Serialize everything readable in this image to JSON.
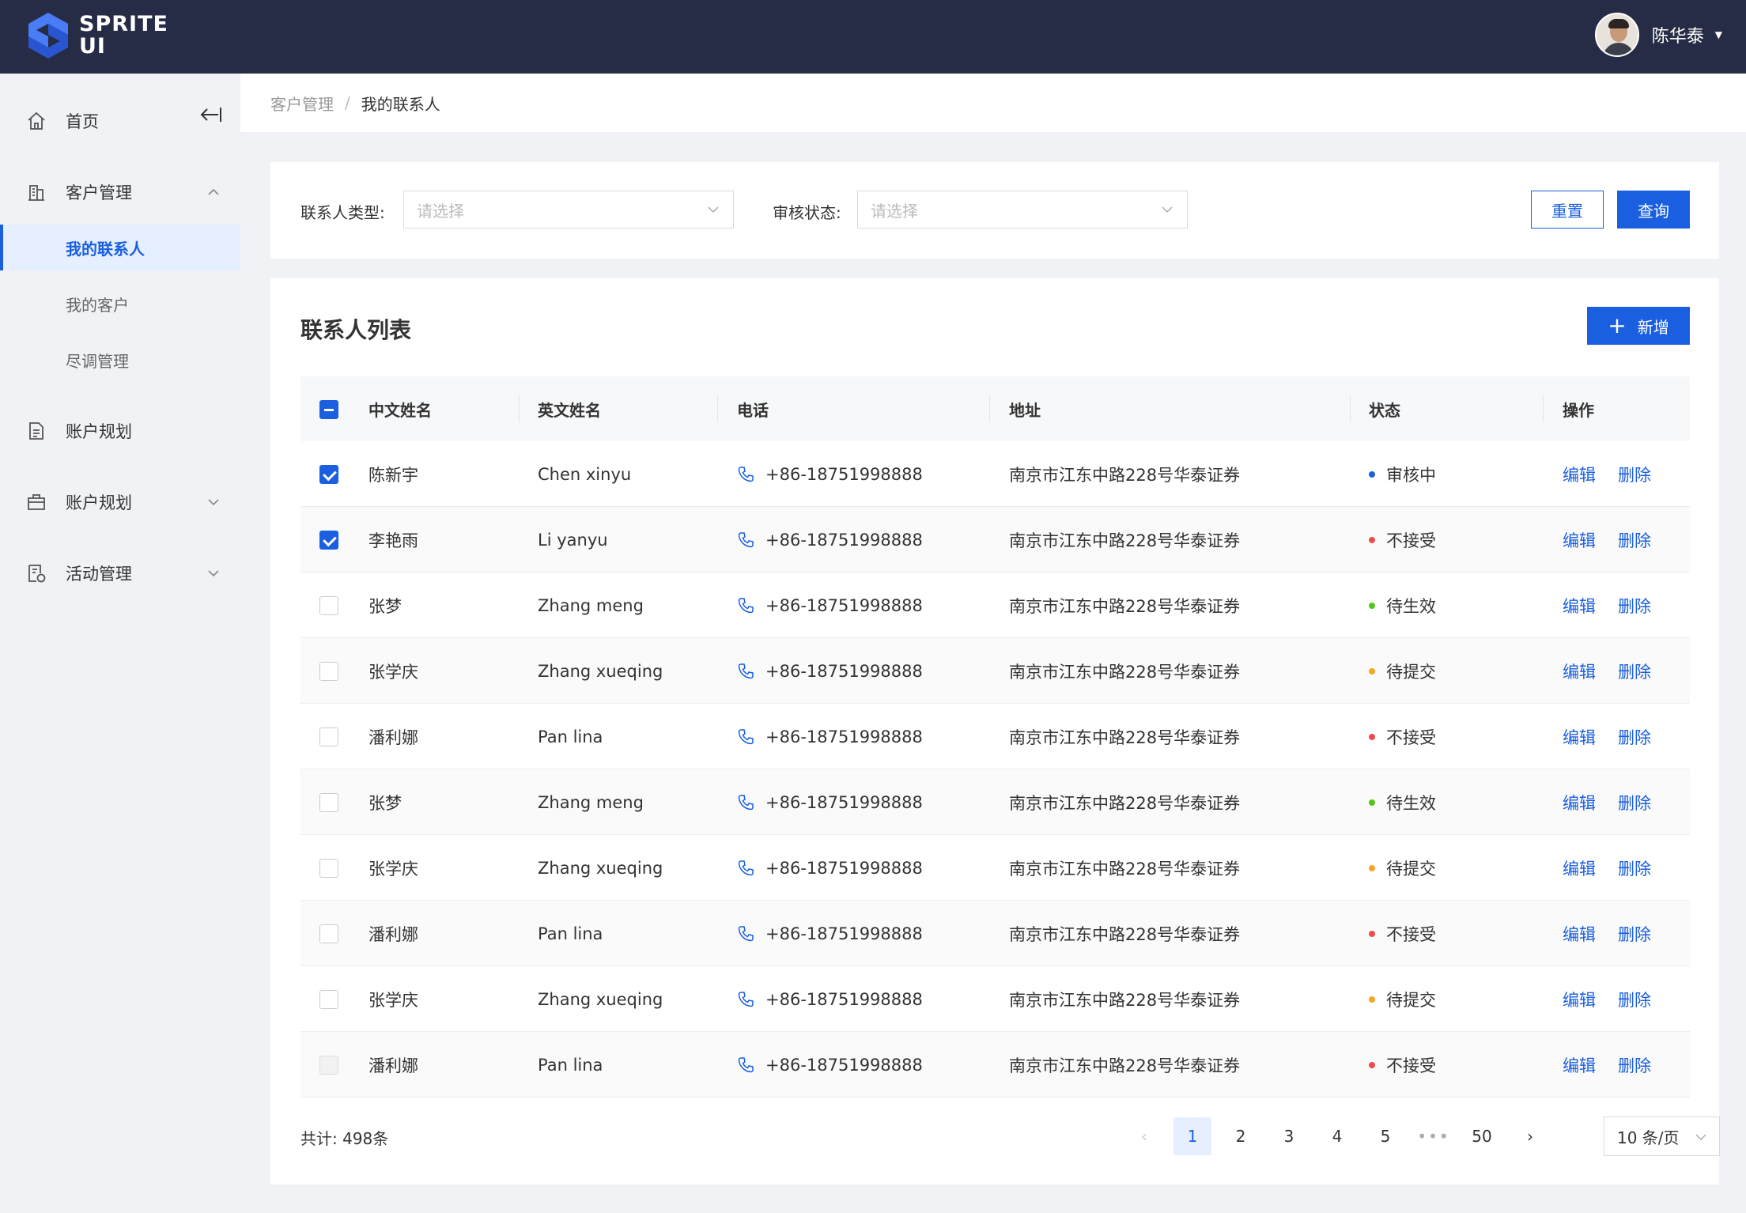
{
  "header": {
    "logo_line1": "SPRITE",
    "logo_line2": "UI",
    "user_name": "陈华泰"
  },
  "sidebar": {
    "items": [
      {
        "label": "首页",
        "icon": "home-icon"
      },
      {
        "label": "客户管理",
        "icon": "building-icon",
        "expanded": true,
        "children": [
          {
            "label": "我的联系人",
            "active": true
          },
          {
            "label": "我的客户"
          },
          {
            "label": "尽调管理"
          }
        ]
      },
      {
        "label": "账户规划",
        "icon": "document-icon"
      },
      {
        "label": "账户规划",
        "icon": "briefcase-icon",
        "expanded": false
      },
      {
        "label": "活动管理",
        "icon": "calendar-list-icon",
        "expanded": false
      }
    ]
  },
  "breadcrumb": {
    "parent": "客户管理",
    "separator": "/",
    "current": "我的联系人"
  },
  "filters": {
    "contact_type_label": "联系人类型:",
    "contact_type_placeholder": "请选择",
    "review_status_label": "审核状态:",
    "review_status_placeholder": "请选择",
    "reset_label": "重置",
    "query_label": "查询"
  },
  "list": {
    "title": "联系人列表",
    "add_label": "新增",
    "columns": [
      "中文姓名",
      "英文姓名",
      "电话",
      "地址",
      "状态",
      "操作"
    ],
    "edit_label": "编辑",
    "delete_label": "删除",
    "rows": [
      {
        "cn": "陈新宇",
        "en": "Chen xinyu",
        "phone": "+86-18751998888",
        "address": "南京市江东中路228号华泰证券",
        "status": "审核中",
        "status_color": "#1a5fe0",
        "checked": true
      },
      {
        "cn": "李艳雨",
        "en": "Li yanyu",
        "phone": "+86-18751998888",
        "address": "南京市江东中路228号华泰证券",
        "status": "不接受",
        "status_color": "#f04b4b",
        "checked": true
      },
      {
        "cn": "张梦",
        "en": "Zhang meng",
        "phone": "+86-18751998888",
        "address": "南京市江东中路228号华泰证券",
        "status": "待生效",
        "status_color": "#52c41a",
        "checked": false
      },
      {
        "cn": "张学庆",
        "en": "Zhang xueqing",
        "phone": "+86-18751998888",
        "address": "南京市江东中路228号华泰证券",
        "status": "待提交",
        "status_color": "#f5a623",
        "checked": false
      },
      {
        "cn": "潘利娜",
        "en": "Pan lina",
        "phone": "+86-18751998888",
        "address": "南京市江东中路228号华泰证券",
        "status": "不接受",
        "status_color": "#f04b4b",
        "checked": false
      },
      {
        "cn": "张梦",
        "en": "Zhang meng",
        "phone": "+86-18751998888",
        "address": "南京市江东中路228号华泰证券",
        "status": "待生效",
        "status_color": "#52c41a",
        "checked": false
      },
      {
        "cn": "张学庆",
        "en": "Zhang xueqing",
        "phone": "+86-18751998888",
        "address": "南京市江东中路228号华泰证券",
        "status": "待提交",
        "status_color": "#f5a623",
        "checked": false
      },
      {
        "cn": "潘利娜",
        "en": "Pan lina",
        "phone": "+86-18751998888",
        "address": "南京市江东中路228号华泰证券",
        "status": "不接受",
        "status_color": "#f04b4b",
        "checked": false
      },
      {
        "cn": "张学庆",
        "en": "Zhang xueqing",
        "phone": "+86-18751998888",
        "address": "南京市江东中路228号华泰证券",
        "status": "待提交",
        "status_color": "#f5a623",
        "checked": false
      },
      {
        "cn": "潘利娜",
        "en": "Pan lina",
        "phone": "+86-18751998888",
        "address": "南京市江东中路228号华泰证券",
        "status": "不接受",
        "status_color": "#f04b4b",
        "checked": false,
        "disabled": true
      }
    ]
  },
  "pagination": {
    "total_text": "共计: 498条",
    "pages": [
      "1",
      "2",
      "3",
      "4",
      "5",
      "•••",
      "50"
    ],
    "current_page": "1",
    "page_size_text": "10 条/页"
  },
  "colors": {
    "primary": "#1a5fe0",
    "header_bg": "#262c45"
  }
}
